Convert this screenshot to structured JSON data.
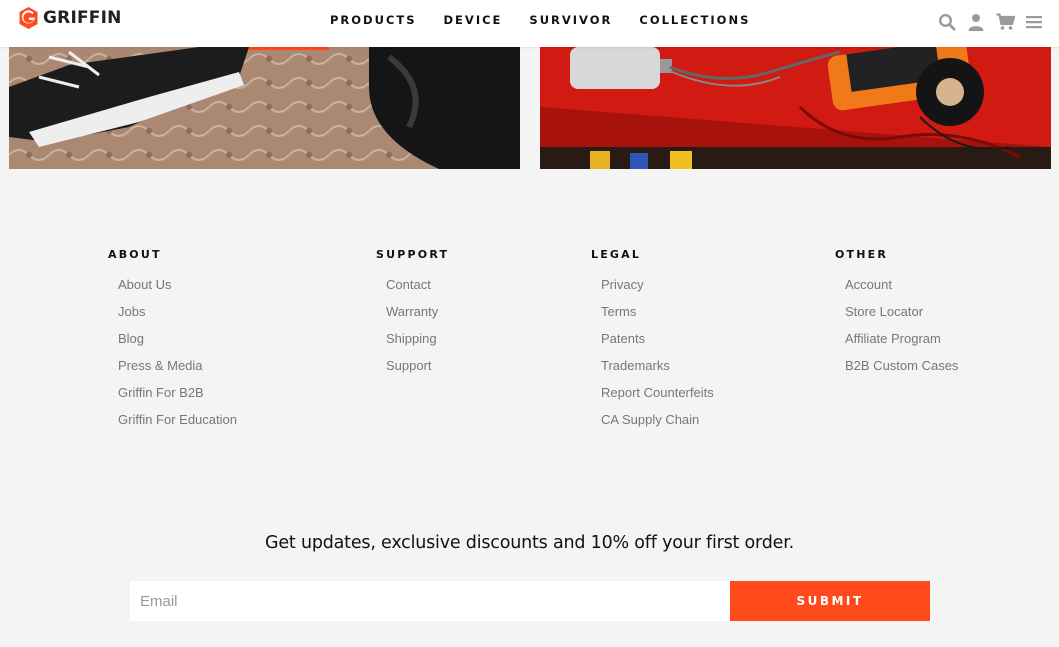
{
  "brand": {
    "name": "GRIFFIN",
    "accent": "#ff4a1c"
  },
  "nav": [
    "PRODUCTS",
    "DEVICE",
    "SURVIVOR",
    "COLLECTIONS"
  ],
  "header_icons": [
    "search-icon",
    "account-icon",
    "cart-icon",
    "menu-icon"
  ],
  "footer": {
    "columns": [
      {
        "title": "ABOUT",
        "links": [
          "About Us",
          "Jobs",
          "Blog",
          "Press & Media",
          "Griffin For B2B",
          "Griffin For Education"
        ]
      },
      {
        "title": "SUPPORT",
        "links": [
          "Contact",
          "Warranty",
          "Shipping",
          "Support"
        ]
      },
      {
        "title": "LEGAL",
        "links": [
          "Privacy",
          "Terms",
          "Patents",
          "Trademarks",
          "Report Counterfeits",
          "CA Supply Chain"
        ]
      },
      {
        "title": "OTHER",
        "links": [
          "Account",
          "Store Locator",
          "Affiliate Program",
          "B2B Custom Cases"
        ]
      }
    ]
  },
  "newsletter": {
    "headline": "Get updates, exclusive discounts and 10% off your first order.",
    "email_placeholder": "Email",
    "email_value": "",
    "submit_label": "SUBMIT"
  }
}
